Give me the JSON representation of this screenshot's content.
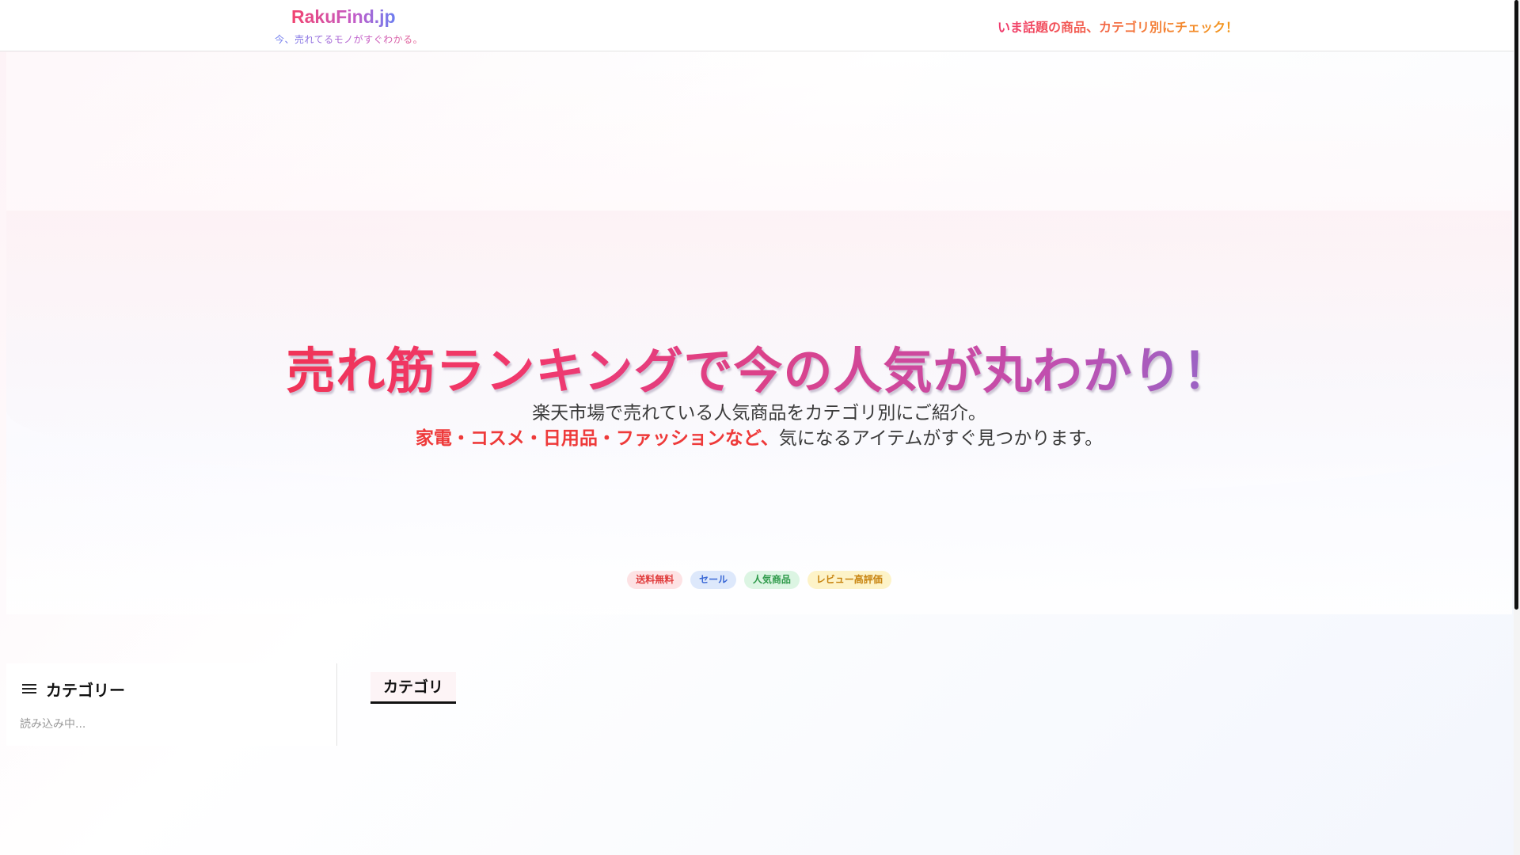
{
  "header": {
    "logo": "RakuFind.jp",
    "tagline": "今、売れてるモノがすぐわかる。",
    "promo": "いま話題の商品、カテゴリ別にチェック！"
  },
  "hero": {
    "title": "売れ筋ランキングで今の人気が丸わかり！",
    "subtitle_line1": "楽天市場で売れている人気商品をカテゴリ別にご紹介。",
    "subtitle_highlight": "家電・コスメ・日用品・ファッションなど、",
    "subtitle_line2_rest": "気になるアイテムがすぐ見つかります。",
    "tags": [
      "送料無料",
      "セール",
      "人気商品",
      "レビュー高評価"
    ]
  },
  "sidebar": {
    "title": "カテゴリー",
    "loading": "読み込み中..."
  },
  "main": {
    "tab_label": "カテゴリ"
  }
}
